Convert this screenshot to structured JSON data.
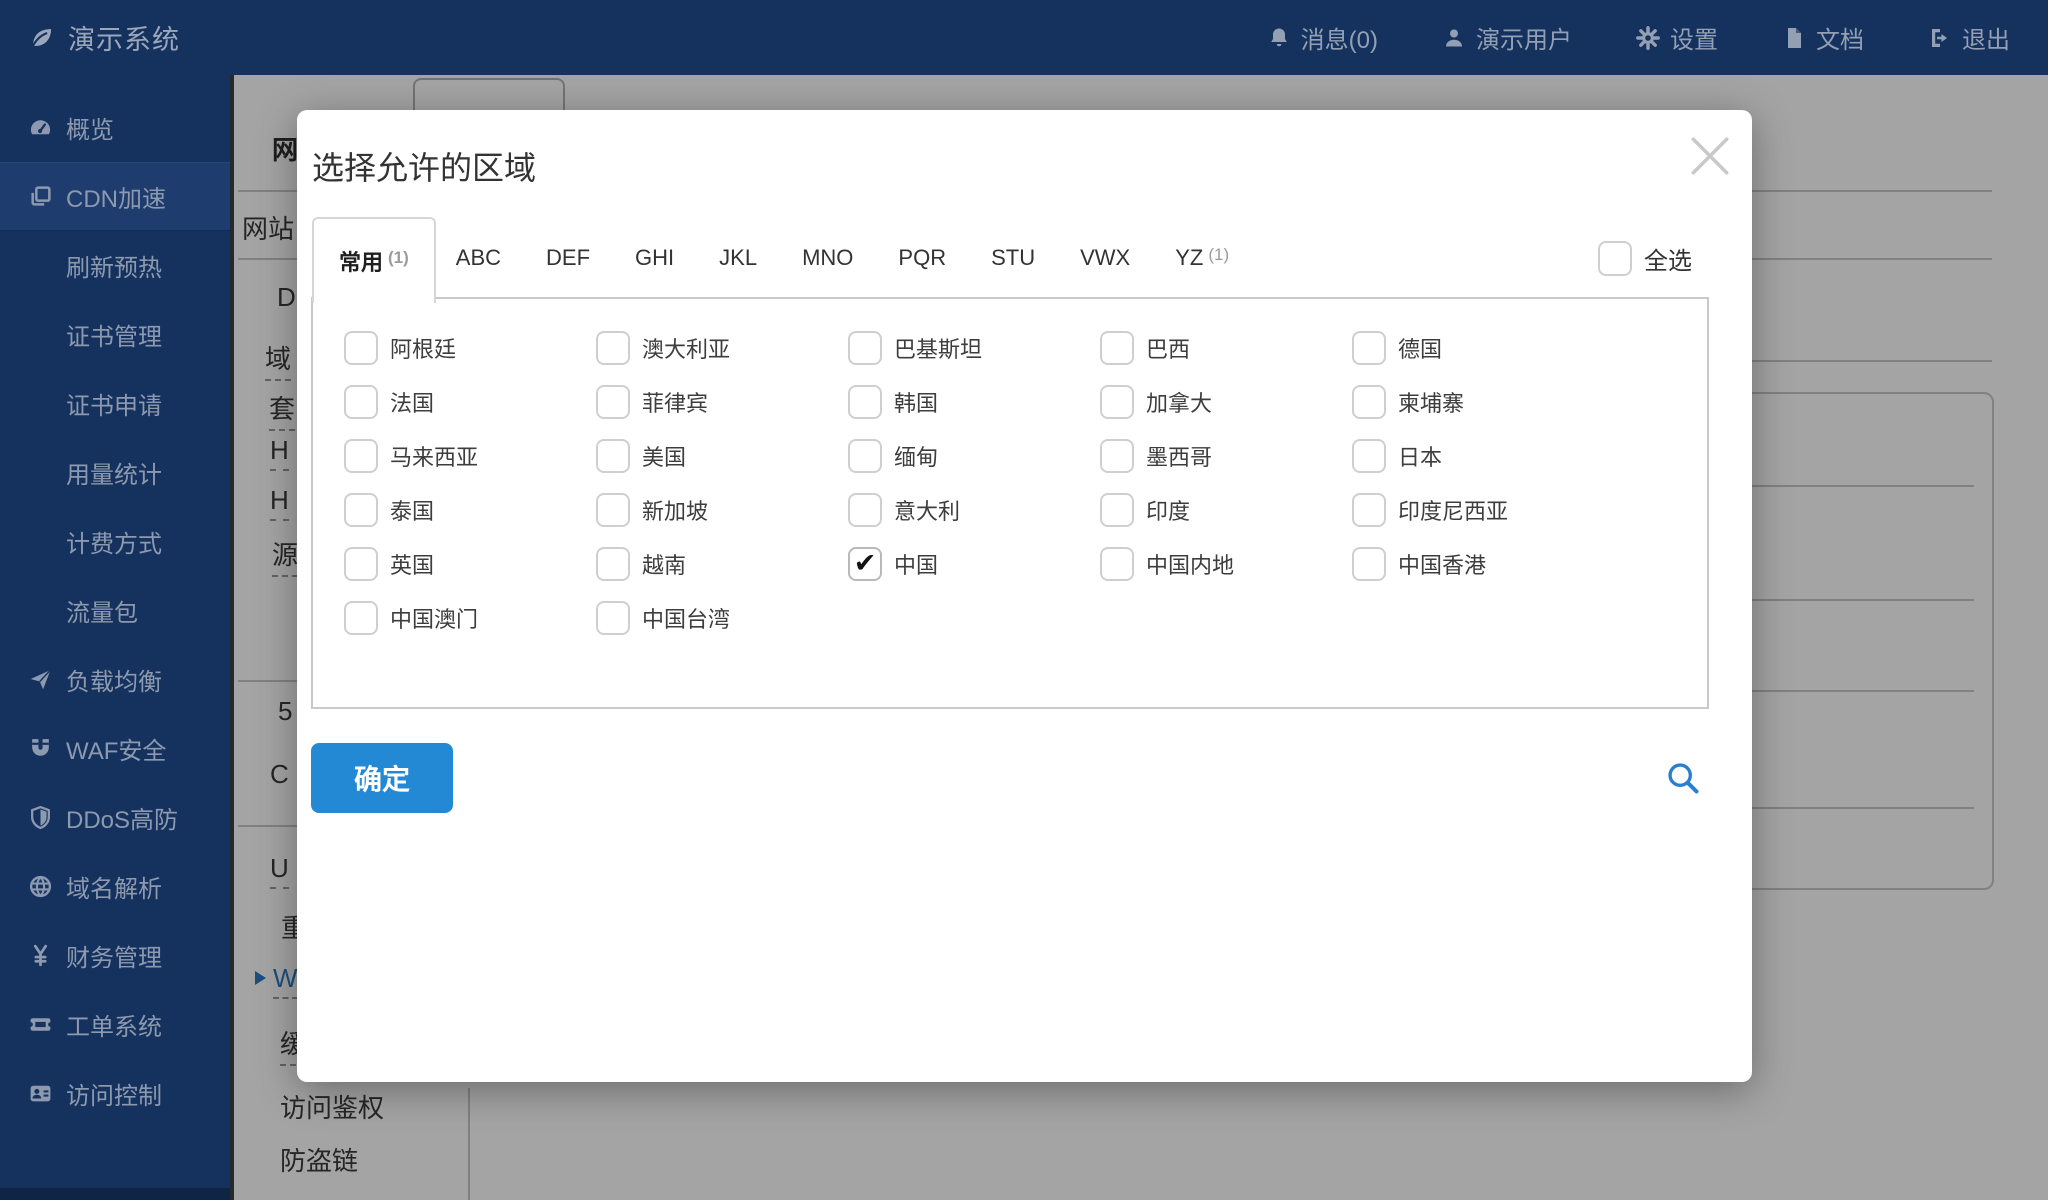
{
  "topbar": {
    "logo_text": "演示系统",
    "menu": [
      {
        "icon": "bell",
        "label": "消息(0)"
      },
      {
        "icon": "user",
        "label": "演示用户"
      },
      {
        "icon": "gear",
        "label": "设置"
      },
      {
        "icon": "doc",
        "label": "文档"
      },
      {
        "icon": "logout",
        "label": "退出"
      }
    ]
  },
  "sidebar": {
    "items": [
      {
        "icon": "gauge",
        "label": "概览"
      },
      {
        "icon": "cdn",
        "label": "CDN加速",
        "active": true
      },
      {
        "label": "刷新预热"
      },
      {
        "label": "证书管理"
      },
      {
        "label": "证书申请"
      },
      {
        "label": "用量统计"
      },
      {
        "label": "计费方式"
      },
      {
        "label": "流量包"
      },
      {
        "icon": "send",
        "label": "负载均衡"
      },
      {
        "icon": "magnet",
        "label": "WAF安全"
      },
      {
        "icon": "shield",
        "label": "DDoS高防"
      },
      {
        "icon": "globe",
        "label": "域名解析"
      },
      {
        "icon": "yen",
        "label": "财务管理"
      },
      {
        "icon": "ticket",
        "label": "工单系统"
      },
      {
        "icon": "idcard",
        "label": "访问控制"
      }
    ]
  },
  "modal": {
    "title": "选择允许的区域",
    "tabs": [
      {
        "label": "常用",
        "count": "(1)",
        "active": true
      },
      {
        "label": "ABC"
      },
      {
        "label": "DEF"
      },
      {
        "label": "GHI"
      },
      {
        "label": "JKL"
      },
      {
        "label": "MNO"
      },
      {
        "label": "PQR"
      },
      {
        "label": "STU"
      },
      {
        "label": "VWX"
      },
      {
        "label": "YZ",
        "count": "(1)"
      }
    ],
    "select_all_label": "全选",
    "ok_label": "确定",
    "regions": [
      {
        "label": "阿根廷",
        "checked": false
      },
      {
        "label": "澳大利亚",
        "checked": false
      },
      {
        "label": "巴基斯坦",
        "checked": false
      },
      {
        "label": "巴西",
        "checked": false
      },
      {
        "label": "德国",
        "checked": false
      },
      {
        "label": "法国",
        "checked": false
      },
      {
        "label": "菲律宾",
        "checked": false
      },
      {
        "label": "韩国",
        "checked": false
      },
      {
        "label": "加拿大",
        "checked": false
      },
      {
        "label": "柬埔寨",
        "checked": false
      },
      {
        "label": "马来西亚",
        "checked": false
      },
      {
        "label": "美国",
        "checked": false
      },
      {
        "label": "缅甸",
        "checked": false
      },
      {
        "label": "墨西哥",
        "checked": false
      },
      {
        "label": "日本",
        "checked": false
      },
      {
        "label": "泰国",
        "checked": false
      },
      {
        "label": "新加坡",
        "checked": false
      },
      {
        "label": "意大利",
        "checked": false
      },
      {
        "label": "印度",
        "checked": false
      },
      {
        "label": "印度尼西亚",
        "checked": false
      },
      {
        "label": "英国",
        "checked": false
      },
      {
        "label": "越南",
        "checked": false
      },
      {
        "label": "中国",
        "checked": true
      },
      {
        "label": "中国内地",
        "checked": false
      },
      {
        "label": "中国香港",
        "checked": false
      },
      {
        "label": "中国澳门",
        "checked": false
      },
      {
        "label": "中国台湾",
        "checked": false
      }
    ]
  },
  "background": {
    "fragments": [
      {
        "text": "网"
      },
      {
        "text": "网站"
      },
      {
        "text": "D"
      },
      {
        "text": "域"
      },
      {
        "text": "套"
      },
      {
        "text": "H"
      },
      {
        "text": "H"
      },
      {
        "text": "源"
      },
      {
        "text": "5"
      },
      {
        "text": "C"
      },
      {
        "text": "U"
      },
      {
        "text": "重"
      },
      {
        "text": "W"
      },
      {
        "text": "缓"
      },
      {
        "text": "访问鉴权"
      },
      {
        "text": "防盗链"
      }
    ]
  },
  "colors": {
    "navy": "#15325f",
    "accent_blue": "#2389d5",
    "link_blue": "#2b7bc4"
  }
}
